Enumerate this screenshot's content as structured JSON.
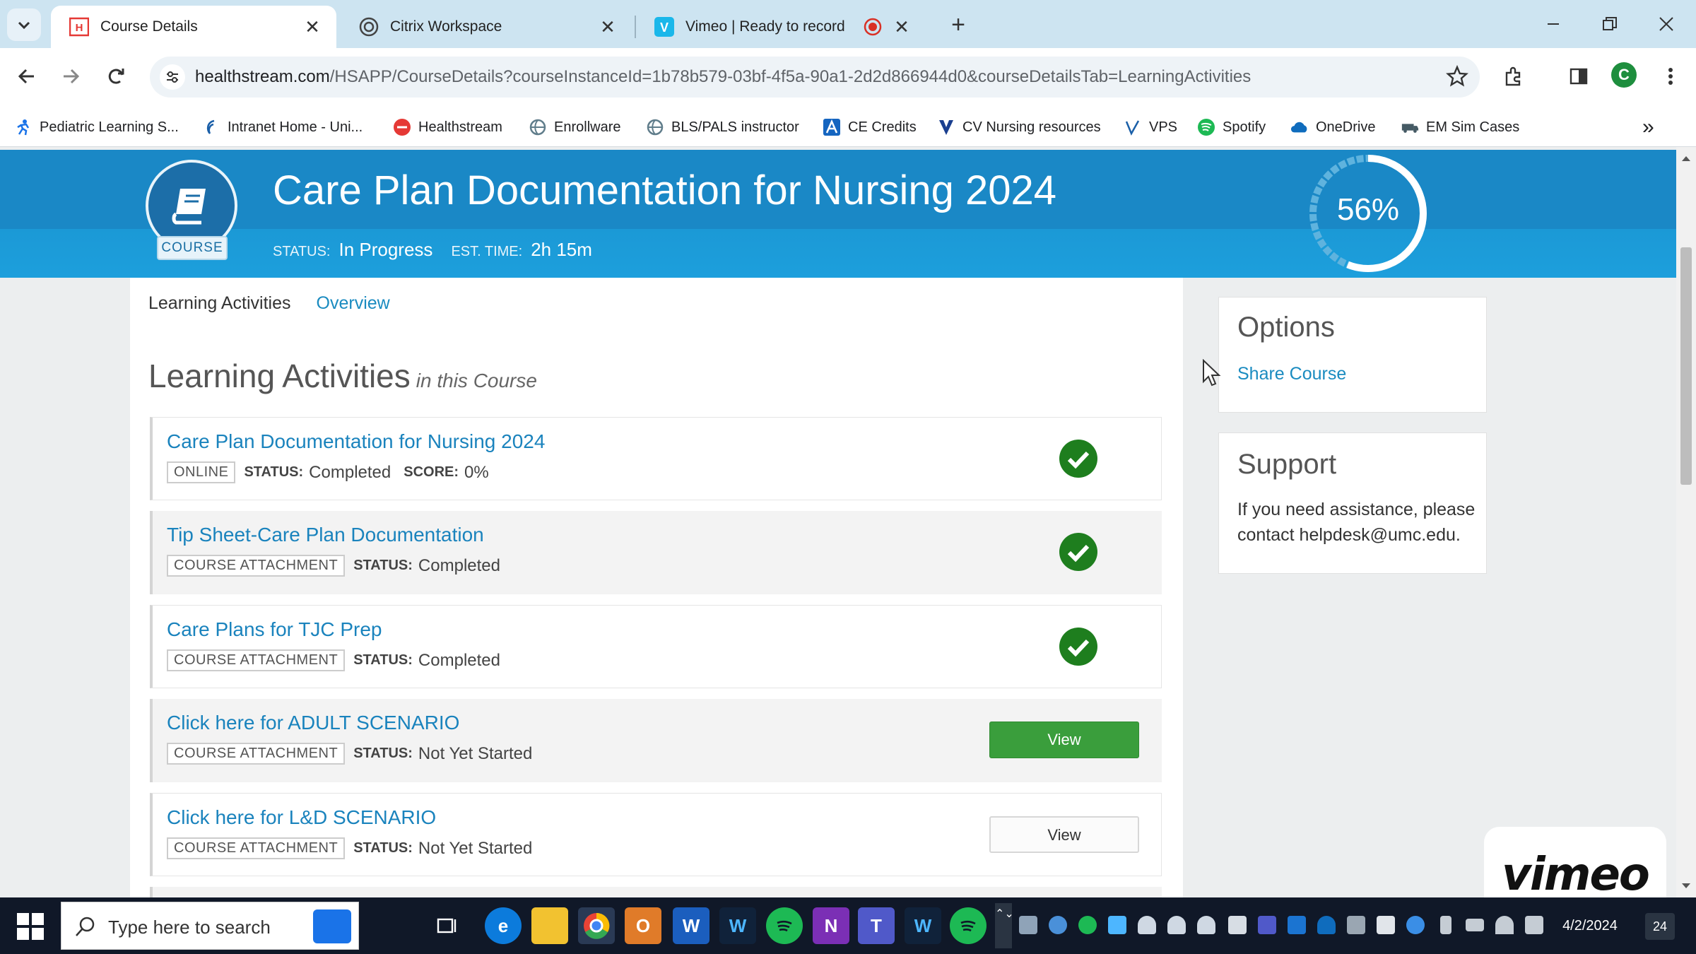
{
  "browser": {
    "tabs": [
      {
        "title": "Course Details",
        "favicon": "healthstream-icon",
        "active": true
      },
      {
        "title": "Citrix Workspace",
        "favicon": "citrix-icon",
        "active": false
      },
      {
        "title": "Vimeo | Ready to record",
        "favicon": "vimeo-icon",
        "active": false,
        "recording": true
      }
    ],
    "new_tab": "+",
    "url_host": "healthstream.com",
    "url_path": "/HSAPP/CourseDetails?courseInstanceId=1b78b579-03bf-4f5a-90a1-2d2d866944d0&courseDetailsTab=LearningActivities",
    "profile_initial": "C",
    "bookmarks": [
      {
        "label": "Pediatric Learning S...",
        "icon": "person-run-icon",
        "color": "#1a73e8"
      },
      {
        "label": "Intranet Home - Uni...",
        "icon": "swirl-icon",
        "color": "#1a5fa8"
      },
      {
        "label": "Healthstream",
        "icon": "healthstream-icon",
        "color": "#e53935"
      },
      {
        "label": "Enrollware",
        "icon": "globe-icon",
        "color": "#607d8b"
      },
      {
        "label": "BLS/PALS instructor",
        "icon": "globe-icon",
        "color": "#607d8b"
      },
      {
        "label": "CE Credits",
        "icon": "a-logo-icon",
        "color": "#1565c0"
      },
      {
        "label": "CV Nursing resources",
        "icon": "shield-icon",
        "color": "#1a3f8f"
      },
      {
        "label": "VPS",
        "icon": "v-logo-icon",
        "color": "#1a5fa8"
      },
      {
        "label": "Spotify",
        "icon": "spotify-icon",
        "color": "#1db954"
      },
      {
        "label": "OneDrive",
        "icon": "cloud-icon",
        "color": "#0f6cbd"
      },
      {
        "label": "EM Sim Cases",
        "icon": "ambulance-icon",
        "color": "#455a64"
      }
    ],
    "bookmarks_more": "»"
  },
  "course": {
    "badge_label": "COURSE",
    "title": "Care Plan Documentation for Nursing 2024",
    "status_label": "STATUS:",
    "status_value": "In Progress",
    "time_label": "EST. TIME:",
    "time_value": "2h 15m",
    "progress_text": "56%",
    "progress": 0.56
  },
  "subtabs": {
    "learning": "Learning Activities",
    "overview": "Overview"
  },
  "activities_heading": {
    "main": "Learning Activities",
    "sub": "in this Course"
  },
  "activities": [
    {
      "title": "Care Plan Documentation for Nursing 2024",
      "tag": "ONLINE",
      "status_label": "STATUS:",
      "status": "Completed",
      "score_label": "SCORE:",
      "score": "0%",
      "state": "complete"
    },
    {
      "title": "Tip Sheet-Care Plan Documentation",
      "tag": "COURSE ATTACHMENT",
      "status_label": "STATUS:",
      "status": "Completed",
      "state": "complete"
    },
    {
      "title": "Care Plans for TJC Prep",
      "tag": "COURSE ATTACHMENT",
      "status_label": "STATUS:",
      "status": "Completed",
      "state": "complete"
    },
    {
      "title": "Click here for ADULT SCENARIO",
      "tag": "COURSE ATTACHMENT",
      "status_label": "STATUS:",
      "status": "Not Yet Started",
      "button": "View",
      "button_style": "primary"
    },
    {
      "title": "Click here for L&D SCENARIO",
      "tag": "COURSE ATTACHMENT",
      "status_label": "STATUS:",
      "status": "Not Yet Started",
      "button": "View",
      "button_style": "secondary"
    }
  ],
  "options": {
    "heading": "Options",
    "share": "Share Course"
  },
  "support": {
    "heading": "Support",
    "text": "If you need assistance, please contact helpdesk@umc.edu."
  },
  "vimeo_watermark": "vimeo",
  "taskbar": {
    "search_placeholder": "Type here to search",
    "apps": [
      "task-view-icon",
      "edge-icon",
      "file-explorer-icon",
      "chrome-icon",
      "outlook-icon",
      "word-icon",
      "webex-icon",
      "spotify-icon",
      "onenote-icon",
      "teams-icon",
      "webex-icon",
      "spotify-icon"
    ],
    "date": "4/2/2024",
    "notifications": "24"
  },
  "colors": {
    "hero_blue": "#1a88c6",
    "link_blue": "#1a83bd",
    "check_green": "#1e7e1e",
    "view_green": "#3a9e3c"
  }
}
